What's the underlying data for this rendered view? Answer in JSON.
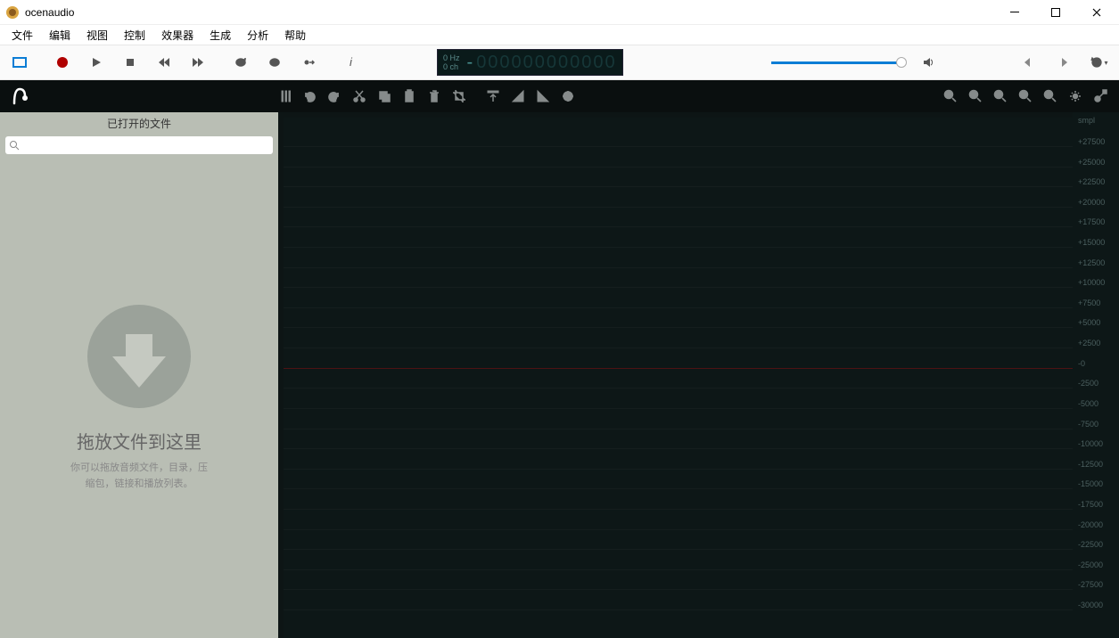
{
  "title": "ocenaudio",
  "menu": [
    "文件",
    "编辑",
    "视图",
    "控制",
    "效果器",
    "生成",
    "分析",
    "帮助"
  ],
  "lcd": {
    "hz": "0 Hz",
    "ch": "0 ch",
    "digits": "000000000000",
    "dash": "-"
  },
  "sidebar": {
    "header": "已打开的文件",
    "drop_title": "拖放文件到这里",
    "drop_sub1": "你可以拖放音频文件，目录，压",
    "drop_sub2": "缩包，链接和播放列表。"
  },
  "ruler": {
    "unit": "smpl",
    "ticks": [
      "+27500",
      "+25000",
      "+22500",
      "+20000",
      "+17500",
      "+15000",
      "+12500",
      "+10000",
      "+7500",
      "+5000",
      "+2500",
      "-0",
      "-2500",
      "-5000",
      "-7500",
      "-10000",
      "-12500",
      "-15000",
      "-17500",
      "-20000",
      "-22500",
      "-25000",
      "-27500",
      "-30000"
    ]
  }
}
